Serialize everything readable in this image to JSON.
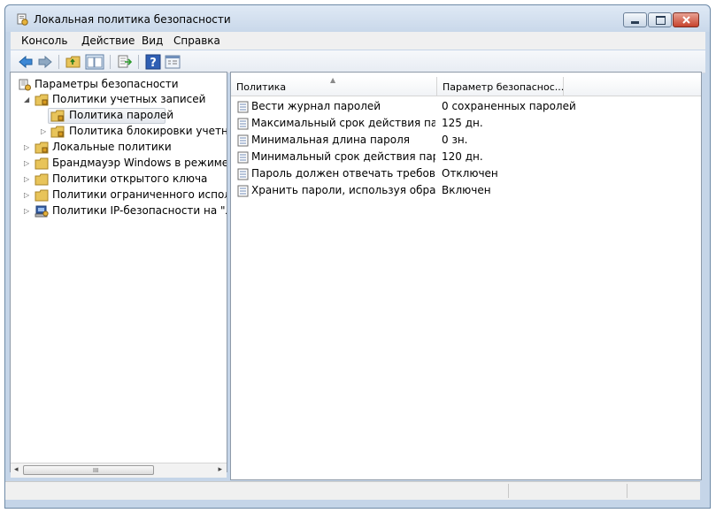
{
  "window": {
    "title": "Локальная политика безопасности"
  },
  "menu": {
    "items": [
      "Консоль",
      "Действие",
      "Вид",
      "Справка"
    ]
  },
  "toolbar": {
    "buttons": [
      "back-arrow",
      "forward-arrow",
      "up-folder",
      "show-hide-tree",
      "export-list",
      "help",
      "properties"
    ]
  },
  "tree": {
    "root": "Параметры безопасности",
    "items": [
      {
        "label": "Политики учетных записей",
        "expanded": true
      },
      {
        "label": "Политика паролей",
        "selected": true
      },
      {
        "label": "Политика блокировки учетной з"
      },
      {
        "label": "Локальные политики"
      },
      {
        "label": "Брандмауэр Windows в режиме пов"
      },
      {
        "label": "Политики открытого ключа"
      },
      {
        "label": "Политики ограниченного использо"
      },
      {
        "label": "Политики IP-безопасности на \"Лока"
      }
    ],
    "scrollbar_grip": "III"
  },
  "list": {
    "columns": [
      "Политика",
      "Параметр безопаснос..."
    ],
    "rows": [
      {
        "name": "Вести журнал паролей",
        "value": "0 сохраненных паролей"
      },
      {
        "name": "Максимальный срок действия паро...",
        "value": "125 дн."
      },
      {
        "name": "Минимальная длина пароля",
        "value": "0 зн."
      },
      {
        "name": "Минимальный срок действия пароля",
        "value": "120 дн."
      },
      {
        "name": "Пароль должен отвечать требовани...",
        "value": "Отключен"
      },
      {
        "name": "Хранить пароли, используя обрати...",
        "value": "Включен"
      }
    ]
  },
  "colors": {
    "frame": "#c5d5e8",
    "close_button": "#c7432d",
    "folder": "#e8c45a"
  }
}
